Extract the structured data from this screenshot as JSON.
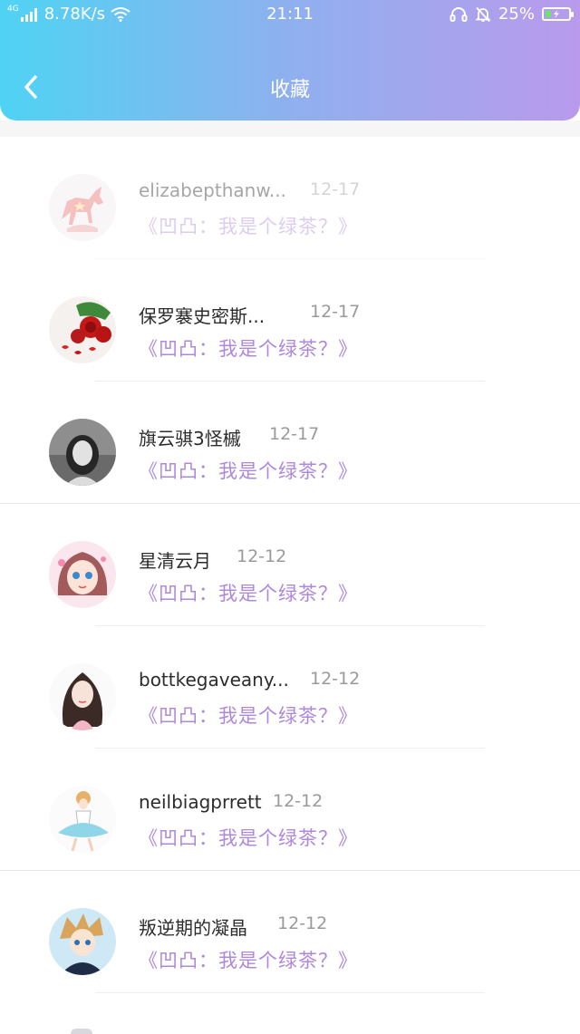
{
  "status_bar": {
    "network_type": "4G",
    "speed": "8.78K/s",
    "time": "21:11",
    "battery": "25%",
    "battery_level": 0.25,
    "icons": [
      "signal-icon",
      "wifi-icon",
      "headset-icon",
      "bell-off-icon",
      "battery-charging-icon"
    ]
  },
  "header": {
    "title": "收藏",
    "back_icon": "chevron-left-icon"
  },
  "favorites": [
    {
      "name": "elizabepthanw...",
      "date": "12-17",
      "quote": "《凹凸：我是个绿茶？》",
      "avatar": "unicorn-avatar",
      "faded": true
    },
    {
      "name": "保罗褰史密斯...",
      "date": "12-17",
      "quote": "《凹凸：我是个绿茶？》",
      "avatar": "roses-avatar"
    },
    {
      "name": "旗云骐3怪槭",
      "date": "12-17",
      "quote": "《凹凸：我是个绿茶？》",
      "avatar": "girl-bw-avatar"
    },
    {
      "name": "星清云月",
      "date": "12-12",
      "quote": "《凹凸：我是个绿茶？》",
      "avatar": "anime-girl-avatar"
    },
    {
      "name": "bottkegaveany...",
      "date": "12-12",
      "quote": "《凹凸：我是个绿茶？》",
      "avatar": "illustrated-girl-avatar"
    },
    {
      "name": "neilbiagprrett",
      "date": "12-12",
      "quote": "《凹凸：我是个绿茶？》",
      "avatar": "dancer-avatar"
    },
    {
      "name": "叛逆期的凝晶",
      "date": "12-12",
      "quote": "《凹凸：我是个绿茶？》",
      "avatar": "anime-boy-avatar"
    }
  ],
  "colors": {
    "header_gradient": [
      "#4fd3f4",
      "#8fb0ee",
      "#b99aec"
    ],
    "quote": "#ae88dc",
    "name": "#2c2c2c",
    "date": "#9a9a9a"
  }
}
